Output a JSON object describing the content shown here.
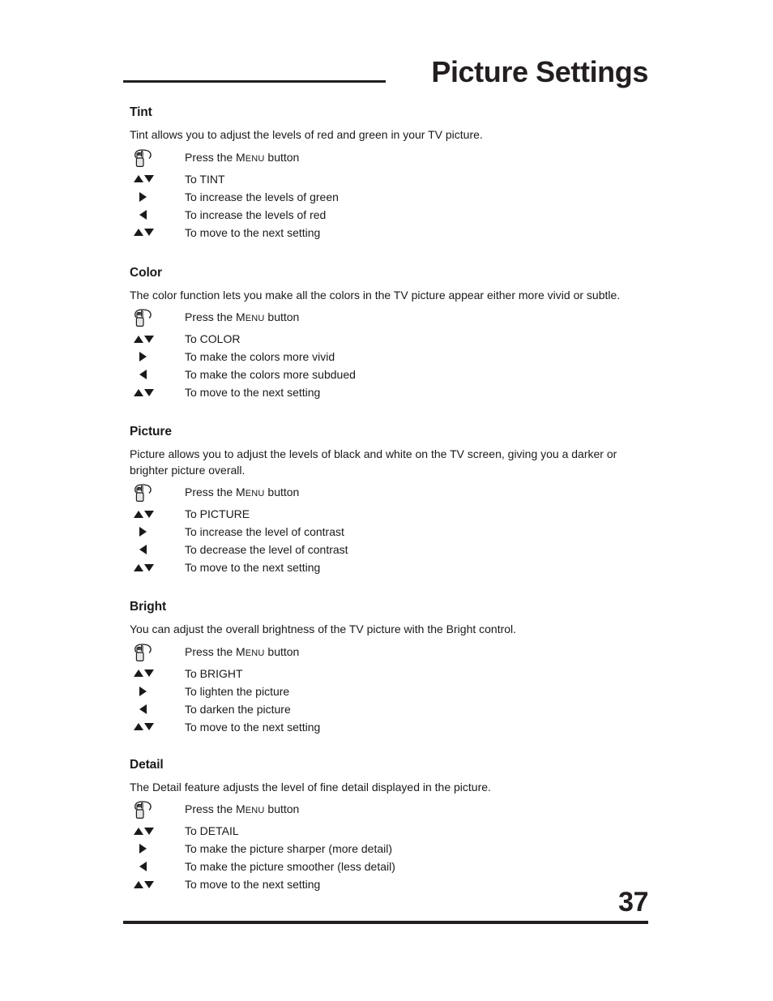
{
  "header": {
    "title": "Picture Settings"
  },
  "press_label": {
    "prefix": "Press the ",
    "menu_first": "M",
    "menu_rest": "ENU",
    "suffix": " button"
  },
  "sections": [
    {
      "heading": "Tint",
      "description": "Tint allows you to adjust the levels of red and green in your TV picture.",
      "steps": [
        {
          "icon": "hand-press-icon",
          "label": "Press the MENU button"
        },
        {
          "icon": "up-down-arrow-icon",
          "label": "To TINT"
        },
        {
          "icon": "right-arrow-icon",
          "label": "To increase the levels of green"
        },
        {
          "icon": "left-arrow-icon",
          "label": "To increase the levels of red"
        },
        {
          "icon": "up-down-arrow-icon",
          "label": "To move to the next setting"
        }
      ]
    },
    {
      "heading": "Color",
      "description": "The color function lets you make all the colors in the TV picture appear either more vivid or subtle.",
      "steps": [
        {
          "icon": "hand-press-icon",
          "label": "Press the MENU button"
        },
        {
          "icon": "up-down-arrow-icon",
          "label": "To COLOR"
        },
        {
          "icon": "right-arrow-icon",
          "label": "To make the colors more vivid"
        },
        {
          "icon": "left-arrow-icon",
          "label": "To make the colors more subdued"
        },
        {
          "icon": "up-down-arrow-icon",
          "label": "To move to the next setting"
        }
      ]
    },
    {
      "heading": "Picture",
      "description": "Picture allows you to adjust the levels of black and white on the TV screen, giving you a darker or brighter picture overall.",
      "steps": [
        {
          "icon": "hand-press-icon",
          "label": "Press the MENU button"
        },
        {
          "icon": "up-down-arrow-icon",
          "label": "To PICTURE"
        },
        {
          "icon": "right-arrow-icon",
          "label": "To increase the level of contrast"
        },
        {
          "icon": "left-arrow-icon",
          "label": "To decrease the level of contrast"
        },
        {
          "icon": "up-down-arrow-icon",
          "label": "To move to the next setting"
        }
      ]
    },
    {
      "heading": "Bright",
      "description": "You can adjust the overall brightness of the TV picture with the Bright control.",
      "steps": [
        {
          "icon": "hand-press-icon",
          "label": "Press the MENU button"
        },
        {
          "icon": "up-down-arrow-icon",
          "label": "To BRIGHT"
        },
        {
          "icon": "right-arrow-icon",
          "label": "To lighten the picture"
        },
        {
          "icon": "left-arrow-icon",
          "label": "To darken the picture"
        },
        {
          "icon": "up-down-arrow-icon",
          "label": "To move to the next setting"
        }
      ]
    },
    {
      "heading": "Detail",
      "description": "The Detail feature adjusts the level of fine detail displayed in the picture.",
      "steps": [
        {
          "icon": "hand-press-icon",
          "label": "Press the MENU button"
        },
        {
          "icon": "up-down-arrow-icon",
          "label": "To DETAIL"
        },
        {
          "icon": "right-arrow-icon",
          "label": "To make the picture sharper (more detail)"
        },
        {
          "icon": "left-arrow-icon",
          "label": "To make the picture smoother (less detail)"
        },
        {
          "icon": "up-down-arrow-icon",
          "label": "To move to the next setting"
        }
      ]
    }
  ],
  "footer": {
    "page_number": "37"
  },
  "colors": {
    "text": "#1a1a1a",
    "rule": "#231f20",
    "button_fill": "#e6e6e6",
    "background": "#ffffff"
  },
  "section_spacing": [
    0,
    30,
    29,
    29,
    27
  ]
}
